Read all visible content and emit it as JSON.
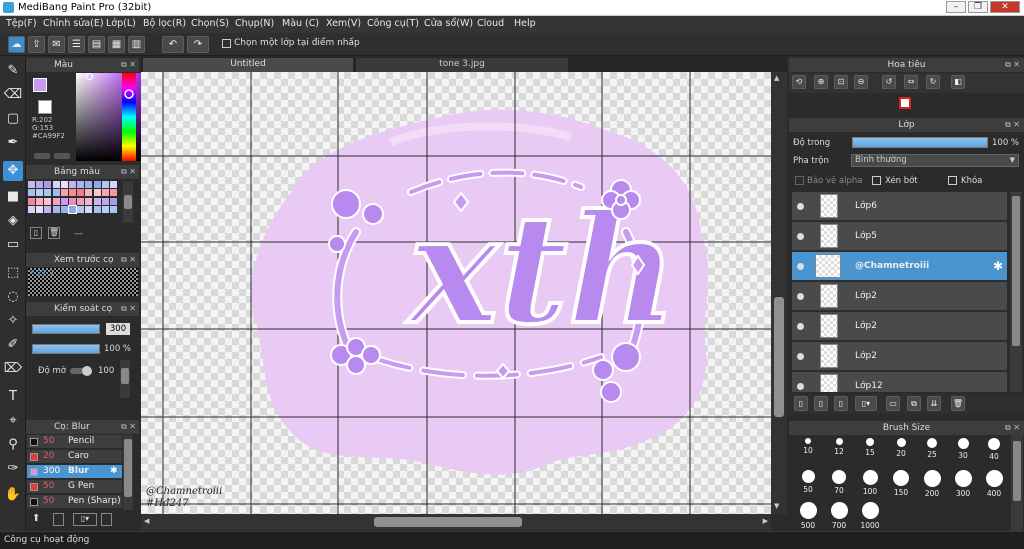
{
  "window": {
    "title": "MediBang Paint Pro (32bit)"
  },
  "menu": [
    "Tệp(F)",
    "Chỉnh sửa(E)",
    "Lớp(L)",
    "Bộ lọc(R)",
    "Chọn(S)",
    "Chụp(N)",
    "Màu (C)",
    "Xem(V)",
    "Công cụ(T)",
    "Cửa sổ(W)",
    "Cloud",
    "Help"
  ],
  "toolbar": {
    "select_layer_label": "Chọn một lớp tại điểm nhấp"
  },
  "panels": {
    "color": {
      "title": "Màu",
      "r": "R:202",
      "g": "G:153",
      "hex": "#CA99F2",
      "fg_color": "#ca99f2",
      "bg_color": "#ffffff"
    },
    "palette": {
      "title": "Bảng màu",
      "footer": "---"
    },
    "preview": {
      "title": "Xem trước cọ",
      "value": "* 21.7"
    },
    "brush_control": {
      "title": "Kiểm soát cọ",
      "size": "300",
      "opacity": "100 %",
      "blur_label": "Độ mờ",
      "blur_value": "100"
    },
    "brushes": {
      "title": "Cọ: Blur",
      "items": [
        {
          "size": "50",
          "name": "Pencil",
          "color": "#111111"
        },
        {
          "size": "20",
          "name": "Caro",
          "color": "#e33b3b"
        },
        {
          "size": "300",
          "name": "Blur",
          "color": "#ca99f2"
        },
        {
          "size": "50",
          "name": "G Pen",
          "color": "#e33b3b"
        },
        {
          "size": "50",
          "name": "Pen (Sharp)",
          "color": "#111111"
        }
      ]
    }
  },
  "tabs": [
    "Untitled",
    "tone 3.jpg"
  ],
  "canvas": {
    "signature_1": "@Chamnetroiii",
    "signature_2": "#Hđ247",
    "art_text": "xth"
  },
  "navigator": {
    "title": "Hoa tiêu"
  },
  "layers_panel": {
    "title": "Lớp",
    "opacity_label": "Độ trong",
    "opacity_value": "100 %",
    "blend_label": "Pha trộn",
    "blend_value": "Bình thường",
    "protect_alpha": "Bảo vệ alpha",
    "clipping": "Xén bớt",
    "lock": "Khóa",
    "layers": [
      {
        "name": "Lớp6",
        "selected": false
      },
      {
        "name": "Lớp5",
        "selected": false
      },
      {
        "name": "@Chamnetroiii",
        "selected": true
      },
      {
        "name": "Lớp2",
        "selected": false
      },
      {
        "name": "Lớp2",
        "selected": false
      },
      {
        "name": "Lớp2",
        "selected": false
      },
      {
        "name": "Lớp12",
        "selected": false
      }
    ]
  },
  "brush_size": {
    "title": "Brush Size",
    "sizes": [
      "10",
      "12",
      "15",
      "20",
      "25",
      "30",
      "40",
      "50",
      "70",
      "100",
      "150",
      "200",
      "300",
      "400",
      "500",
      "700",
      "1000"
    ]
  },
  "status": {
    "text": "Công cụ hoạt động"
  }
}
